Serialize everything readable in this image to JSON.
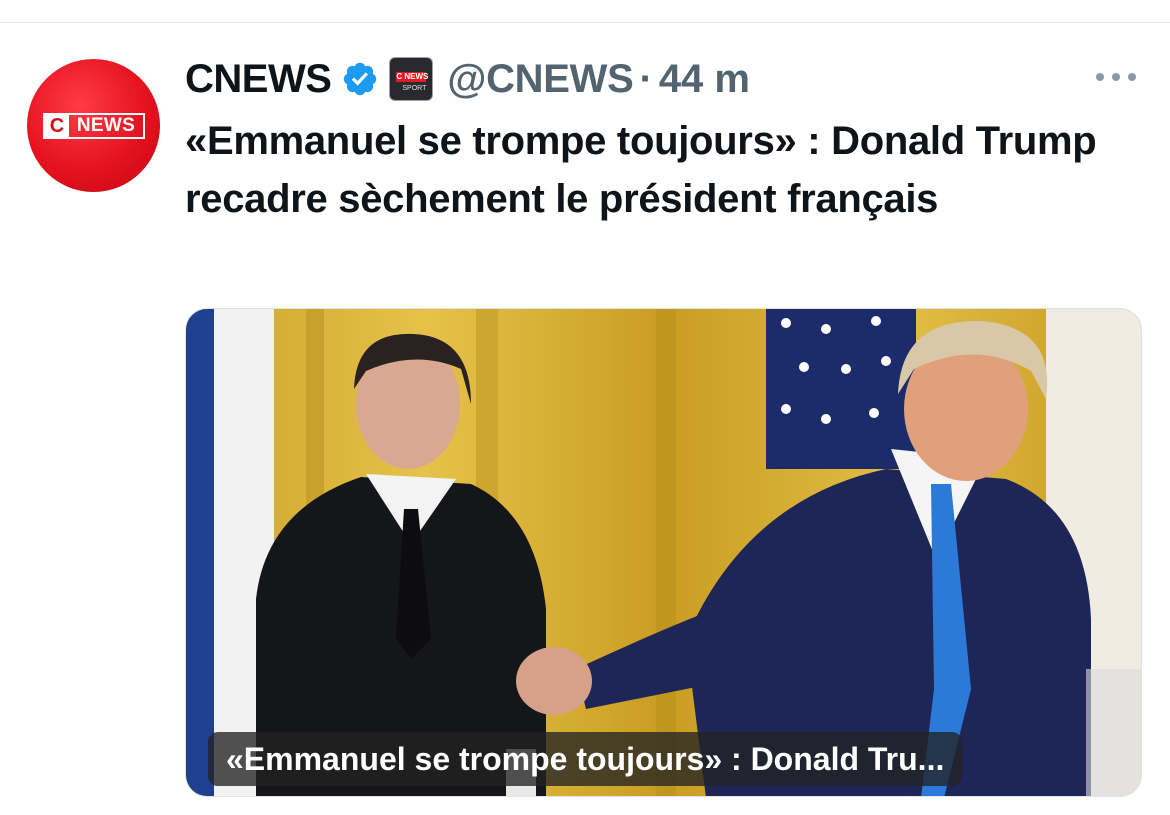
{
  "account": {
    "display_name": "CNEWS",
    "handle": "@CNEWS",
    "separator": "·",
    "time": "44 m",
    "avatar_logo": {
      "c": "C",
      "news": "NEWS"
    },
    "affiliate_badge": {
      "c": "C NEWS",
      "sub": "SPORT"
    }
  },
  "tweet": {
    "text": "«Emmanuel se trompe toujours» : Donald Trump recadre sèchement le président français"
  },
  "media": {
    "caption": "«Emmanuel se trompe toujours» : Donald Tru..."
  },
  "colors": {
    "brand_red": "#e5121f",
    "verified_blue": "#1d9bf0",
    "secondary_text": "#536471"
  },
  "icons": [
    "verified-icon",
    "more-icon"
  ]
}
